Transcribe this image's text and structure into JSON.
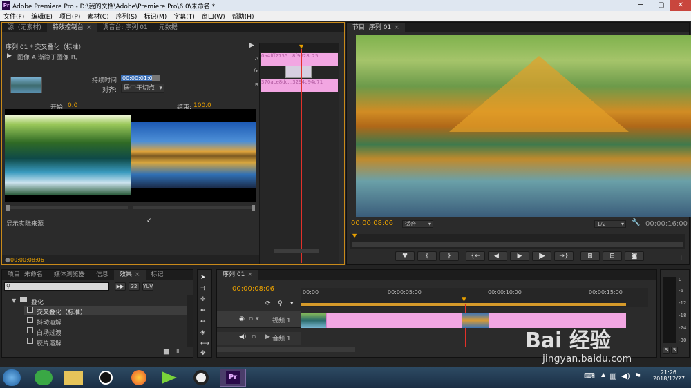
{
  "app": {
    "logo": "Pr",
    "title": "Adobe Premiere Pro - D:\\我的文档\\Adobe\\Premiere Pro\\6.0\\未命名 *",
    "window_controls": [
      "minimize-icon",
      "maximize-icon",
      "close-icon"
    ]
  },
  "menu": [
    "文件(F)",
    "编辑(E)",
    "项目(P)",
    "素材(C)",
    "序列(S)",
    "标记(M)",
    "字幕(T)",
    "窗口(W)",
    "帮助(H)"
  ],
  "effect_controls": {
    "tabs": [
      "源: (无素材)",
      "特效控制台",
      "调音台: 序列 01",
      "元数据"
    ],
    "active_tab": "特效控制台",
    "sequence_label": "序列 01 * 交叉叠化（标准）",
    "description": "图像 A 渐隐于图像 B。",
    "duration_label": "持续时间",
    "duration_value": "00:00:01:00",
    "align_label": "对齐:",
    "align_value": "居中于切点",
    "start_label": "开始:",
    "start_value": "0.0",
    "end_label": "结束:",
    "end_value": "100.0",
    "show_actual_sources": "显示实际来源",
    "show_actual_checked": true,
    "timecode": "00:00:08:06",
    "clip_a_label": "A",
    "clip_b_label": "B",
    "fx_label": "fx",
    "clip_a_name": "0a4fff2735...8f9628c25",
    "clip_b_name": "370ace8dc...3294d94c71"
  },
  "program_monitor": {
    "tab": "节目: 序列 01",
    "timecode": "00:00:08:06",
    "fit": "适合",
    "resolution": "1/2",
    "duration": "00:00:16:00",
    "controls": [
      "marker-icon",
      "in-point-icon",
      "out-point-icon",
      "go-to-in-icon",
      "step-back-icon",
      "play-icon",
      "step-forward-icon",
      "go-to-out-icon",
      "lift-icon",
      "extract-icon",
      "export-frame-icon"
    ]
  },
  "project": {
    "tabs": [
      "项目: 未命名",
      "媒体浏览器",
      "信息",
      "效果",
      "标记"
    ],
    "active_tab": "效果",
    "folder": "叠化",
    "items": [
      "交叉叠化（标准）",
      "抖动溶解",
      "白场过渡",
      "胶片溶解"
    ],
    "search_placeholder": ""
  },
  "timeline": {
    "tab": "序列 01",
    "timecode": "00:00:08:06",
    "ruler": [
      "00:00",
      "00:00:05:00",
      "00:00:10:00",
      "00:00:15:00"
    ],
    "video_track": "视频 1",
    "audio_track": "音频 1",
    "playhead_fraction": 0.51
  },
  "audio_meter": {
    "scale": [
      "0",
      "-6",
      "-12",
      "-18",
      "-24",
      "-30"
    ],
    "solo": [
      "S",
      "S"
    ]
  },
  "watermark": {
    "brand": "Bai  经验",
    "url": "jingyan.baidu.com"
  },
  "taskbar": {
    "time": "21:26",
    "date": "2018/12/27",
    "apps": [
      "360-browser-icon",
      "file-explorer-icon",
      "qq-icon",
      "firefox-icon",
      "video-editor-icon",
      "record-icon",
      "premiere-icon"
    ]
  },
  "colors": {
    "accent": "#e8a000",
    "clip": "#f2a6e2",
    "playhead": "#e2312a",
    "panel": "#2b2b2b"
  }
}
